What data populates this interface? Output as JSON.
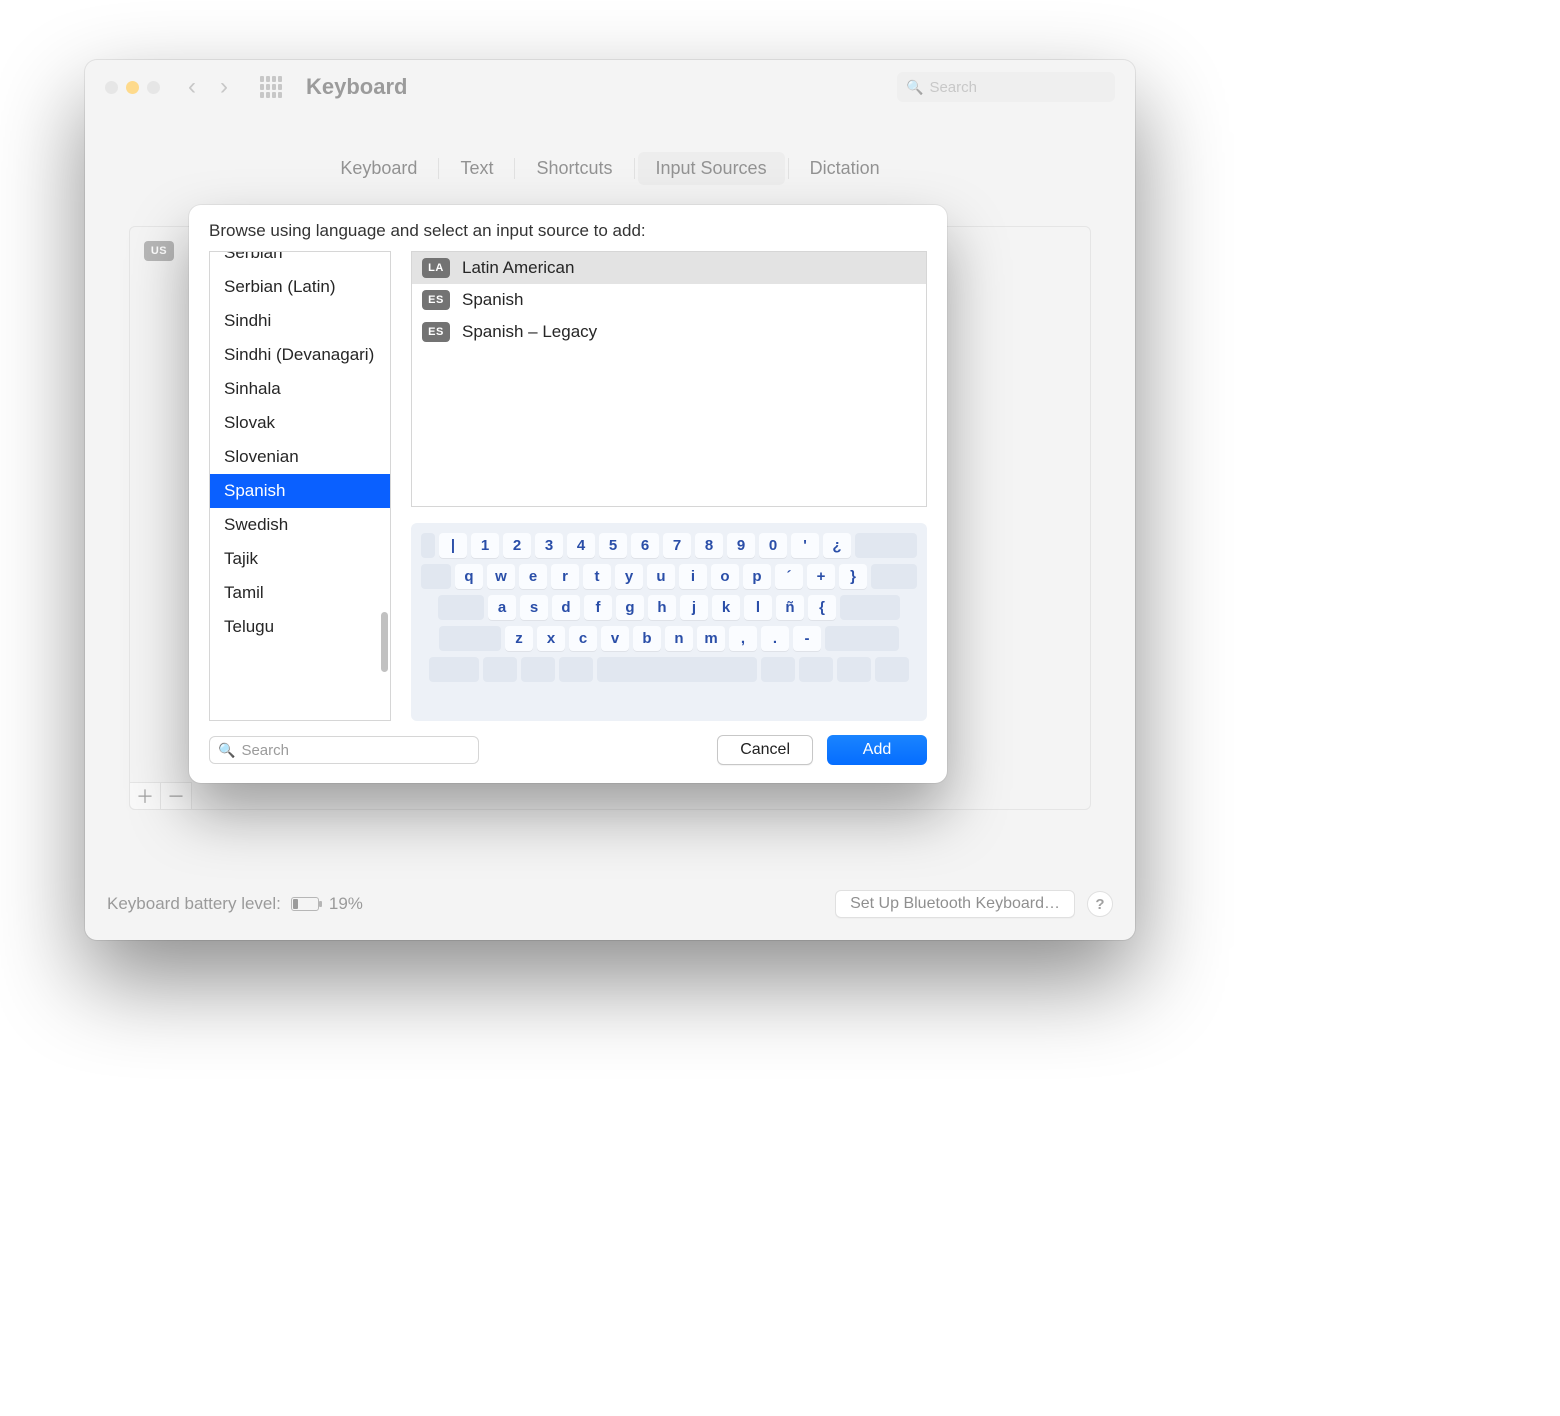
{
  "window": {
    "title": "Keyboard",
    "search_placeholder": "Search"
  },
  "tabs": [
    "Keyboard",
    "Text",
    "Shortcuts",
    "Input Sources",
    "Dictation"
  ],
  "active_tab_index": 3,
  "background": {
    "current_source_badge": "US",
    "plus": "＋",
    "minus": "－"
  },
  "footer": {
    "battery_label": "Keyboard battery level:",
    "battery_pct": "19%",
    "bluetooth_btn": "Set Up Bluetooth Keyboard…",
    "help": "?"
  },
  "dialog": {
    "header": "Browse using language and select an input source to add:",
    "languages": [
      "Serbian",
      "Serbian (Latin)",
      "Sindhi",
      "Sindhi (Devanagari)",
      "Sinhala",
      "Slovak",
      "Slovenian",
      "Spanish",
      "Swedish",
      "Tajik",
      "Tamil",
      "Telugu"
    ],
    "selected_language_index": 7,
    "sources": [
      {
        "badge": "LA",
        "name": "Latin American"
      },
      {
        "badge": "ES",
        "name": "Spanish"
      },
      {
        "badge": "ES",
        "name": "Spanish – Legacy"
      }
    ],
    "selected_source_index": 0,
    "search_placeholder": "Search",
    "cancel": "Cancel",
    "add": "Add",
    "keyboard_rows": [
      [
        "|",
        "1",
        "2",
        "3",
        "4",
        "5",
        "6",
        "7",
        "8",
        "9",
        "0",
        "'",
        "¿"
      ],
      [
        "q",
        "w",
        "e",
        "r",
        "t",
        "y",
        "u",
        "i",
        "o",
        "p",
        "´",
        "+",
        "}"
      ],
      [
        "a",
        "s",
        "d",
        "f",
        "g",
        "h",
        "j",
        "k",
        "l",
        "ñ",
        "{"
      ],
      [
        "z",
        "x",
        "c",
        "v",
        "b",
        "n",
        "m",
        ",",
        ".",
        "-"
      ]
    ]
  }
}
